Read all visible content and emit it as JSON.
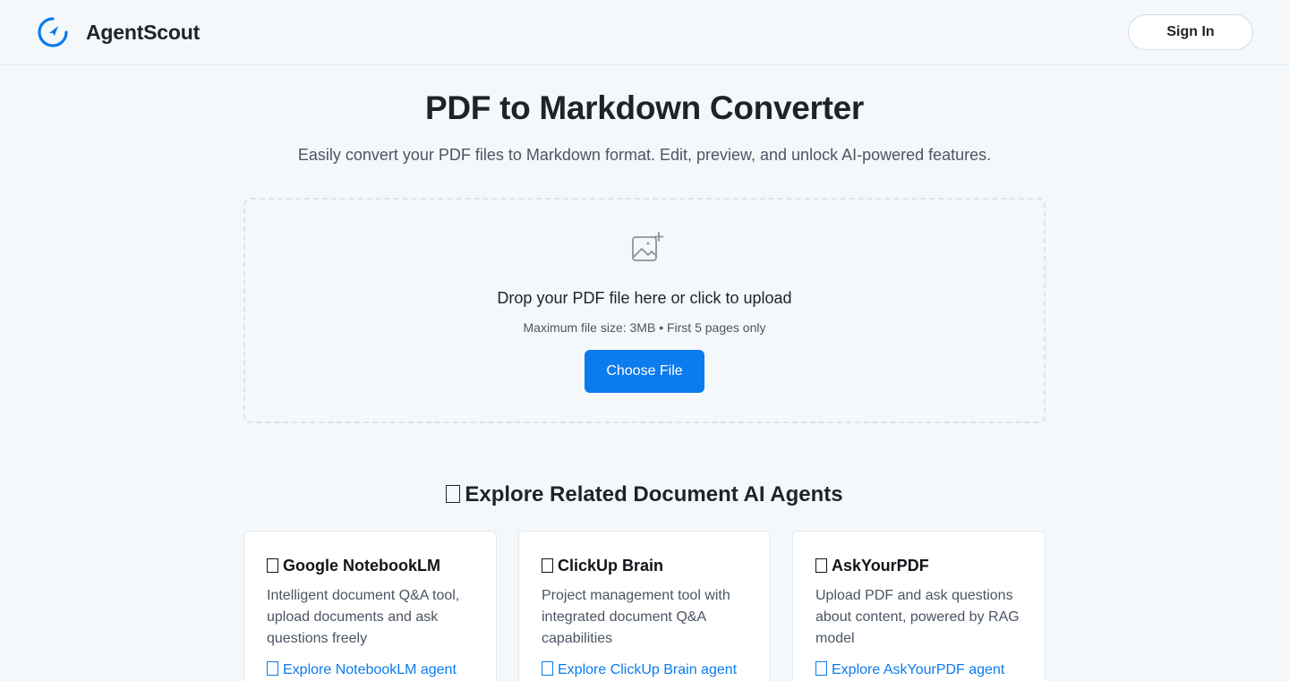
{
  "header": {
    "brand": "AgentScout",
    "sign_in_label": "Sign In",
    "logo_icon": "compass-logo-icon"
  },
  "hero": {
    "title": "PDF to Markdown Converter",
    "subtitle": "Easily convert your PDF files to Markdown format. Edit, preview, and unlock AI-powered features."
  },
  "upload": {
    "icon": "image-add-icon",
    "title": "Drop your PDF file here or click to upload",
    "hint": "Maximum file size: 3MB • First 5 pages only",
    "button_label": "Choose File"
  },
  "related": {
    "section_title": "Explore Related Document AI Agents",
    "cards": [
      {
        "title": "Google NotebookLM",
        "description": "Intelligent document Q&A tool, upload documents and ask questions freely",
        "link": "Explore NotebookLM agent"
      },
      {
        "title": "ClickUp Brain",
        "description": "Project management tool with integrated document Q&A capabilities",
        "link": "Explore ClickUp Brain agent"
      },
      {
        "title": "AskYourPDF",
        "description": "Upload PDF and ask questions about content, powered by RAG model",
        "link": "Explore AskYourPDF agent"
      }
    ]
  },
  "colors": {
    "accent": "#0b7bee",
    "background": "#f5f8fb",
    "text": "#1f2329",
    "muted": "#4b5563"
  }
}
